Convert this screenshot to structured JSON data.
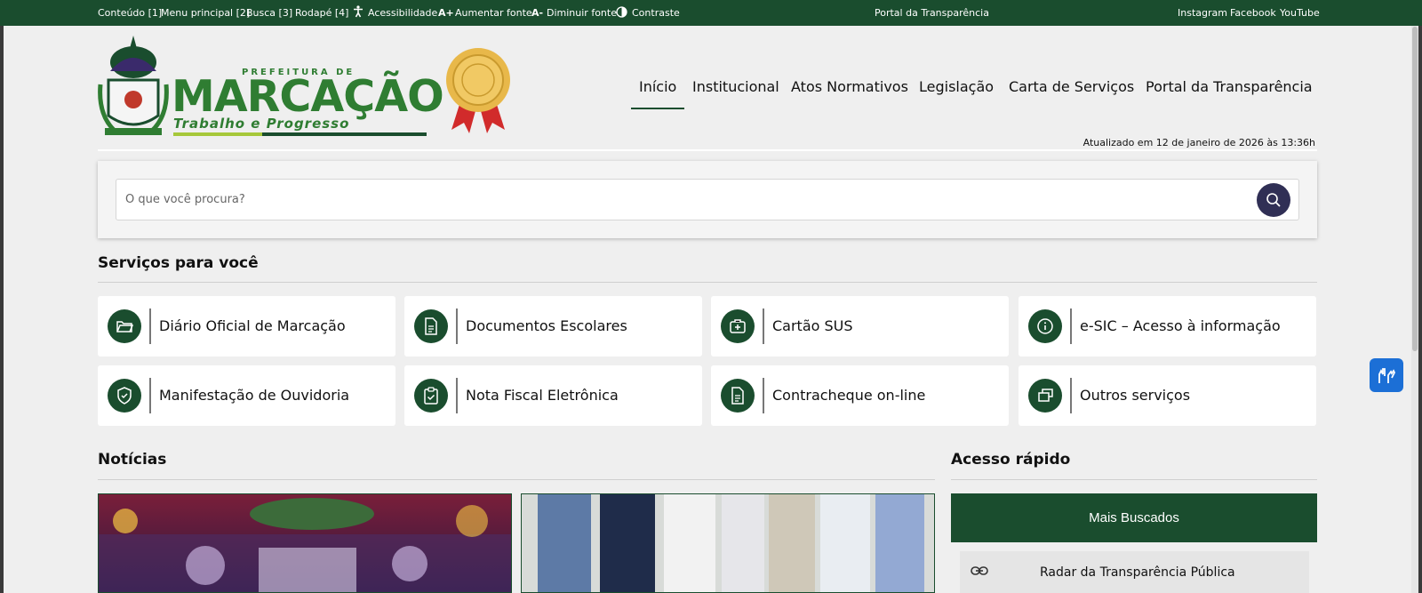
{
  "colors": {
    "brand_green": "#1a4d2e",
    "accent_green": "#2f7d32",
    "search_button": "#302f55",
    "vlibras_blue": "#1c6fd6"
  },
  "topbar": {
    "skip_content": "Conteúdo [1]",
    "skip_menu": "Menu principal [2]",
    "skip_search": "Busca [3]",
    "skip_footer": "Rodapé [4]",
    "accessibility": "Acessibilidade",
    "font_up": "Aumentar fonte",
    "font_up_icon": "A+",
    "font_down": "Diminuir fonte",
    "font_down_icon": "A-",
    "contrast": "Contraste",
    "center_link": "Portal da Transparência",
    "social": [
      "Instagram",
      "Facebook",
      "YouTube"
    ]
  },
  "logo": {
    "brand_prefix": "PREFEITURA DE",
    "brand_name": "MARCAÇÃO",
    "motto": "Trabalho e Progresso",
    "icons": [
      "crest-icon",
      "seal-medal-icon"
    ]
  },
  "nav": {
    "items": [
      "Início",
      "Institucional",
      "Atos Normativos",
      "Legislação",
      "Carta de Serviços",
      "Portal da Transparência"
    ],
    "active": "Início"
  },
  "updated": "Atualizado em 12 de janeiro de 2026 às 13:36h",
  "search": {
    "placeholder": "O que você procura?",
    "icon": "search-icon"
  },
  "services": {
    "title": "Serviços para você",
    "items": [
      {
        "label": "Diário Oficial de Marcação",
        "icon": "folder-icon"
      },
      {
        "label": "Documentos Escolares",
        "icon": "document-icon"
      },
      {
        "label": "Cartão SUS",
        "icon": "medical-case-icon"
      },
      {
        "label": "e-SIC – Acesso à informação",
        "icon": "info-icon"
      },
      {
        "label": "Manifestação de Ouvidoria",
        "icon": "shield-check-icon"
      },
      {
        "label": "Nota Fiscal Eletrônica",
        "icon": "clipboard-check-icon"
      },
      {
        "label": "Contracheque on-line",
        "icon": "document-icon"
      },
      {
        "label": "Outros serviços",
        "icon": "stacked-windows-icon"
      }
    ]
  },
  "news": {
    "title": "Notícias"
  },
  "quick": {
    "title": "Acesso rápido",
    "header": "Mais Buscados",
    "items": [
      {
        "label": "Radar da Transparência Pública",
        "icon": "link-icon"
      }
    ]
  },
  "floating": {
    "icon": "sign-language-hands-icon"
  }
}
